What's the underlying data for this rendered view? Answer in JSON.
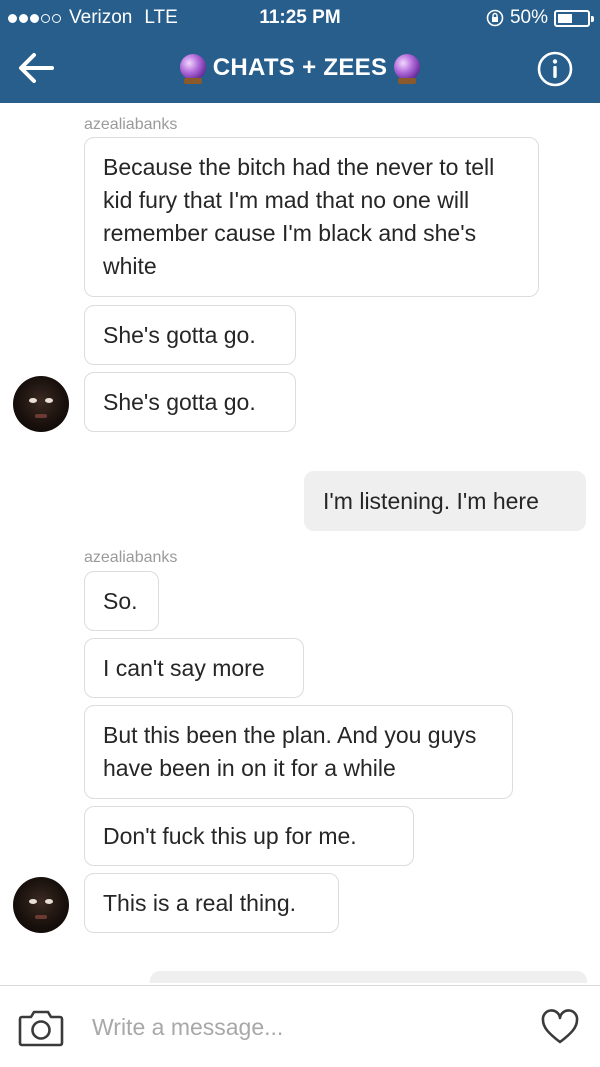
{
  "status_bar": {
    "carrier": "Verizon",
    "network": "LTE",
    "time": "11:25 PM",
    "battery": "50%",
    "battery_level": 0.5,
    "signal_bars": 3,
    "signal_max": 5
  },
  "header": {
    "title": "CHATS + ZEES",
    "title_icon": "crystal-ball-icon",
    "back_icon": "arrow-left-icon",
    "info_icon": "info-icon",
    "background_color": "#275e8c"
  },
  "thread": {
    "sender_1": "azealiabanks",
    "msg_1": "Because the bitch had the never to tell kid fury that I'm mad that no one will remember cause I'm black and she's white",
    "msg_2": "She's gotta go.",
    "msg_3": "She's gotta go.",
    "msg_4_own": "I'm listening. I'm here",
    "sender_2": "azealiabanks",
    "msg_5": "So.",
    "msg_6": "I can't say more",
    "msg_7": "But this been the plan. And you guys have been in on it for a while",
    "msg_8": "Don't fuck this up for me.",
    "msg_9": "This is a real thing."
  },
  "composer": {
    "placeholder": "Write a message...",
    "camera_icon": "camera-icon",
    "heart_icon": "heart-icon"
  }
}
